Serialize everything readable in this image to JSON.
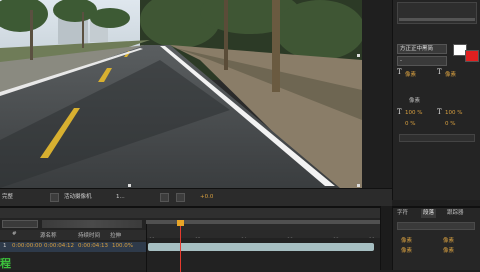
{
  "viewer": {
    "scene": "road-footage"
  },
  "right_panel": {
    "font_dropdown": "方正正中黑简",
    "style_dropdown": "-",
    "text_icons": [
      "T",
      "T",
      "T",
      "T"
    ],
    "size_values": [
      "像素",
      "像素"
    ],
    "spacing_label": "像素",
    "scale_values": [
      "100 %",
      "100 %"
    ],
    "shift_values": [
      "0 %",
      "0 %"
    ],
    "colors": {
      "fill": "#ffffff",
      "stroke": "#e02020"
    }
  },
  "viewer_toolbar": {
    "zoom_dd": "完整",
    "camera_dd": "活动摄像机",
    "views_dd": "1...",
    "offset_value": "+0.0"
  },
  "timeline": {
    "tab_label": "",
    "search_placeholder": "",
    "time_marks": [
      "00s",
      "02s",
      "04s",
      "06s",
      "08s",
      "10s"
    ],
    "columns": [
      "#",
      "源名称",
      "持续时间",
      "拉伸"
    ],
    "layer": {
      "index": "1",
      "in_time": "0:00:00:00",
      "out_time": "0:00:04:12",
      "duration": "0:00:04:13",
      "stretch": "100.0%"
    }
  },
  "bottom_right": {
    "tabs": [
      "字符",
      "段落",
      "跟踪器"
    ],
    "rows": [
      "像素",
      "像素",
      "像素",
      "像素"
    ]
  },
  "corner_glyph": "程"
}
